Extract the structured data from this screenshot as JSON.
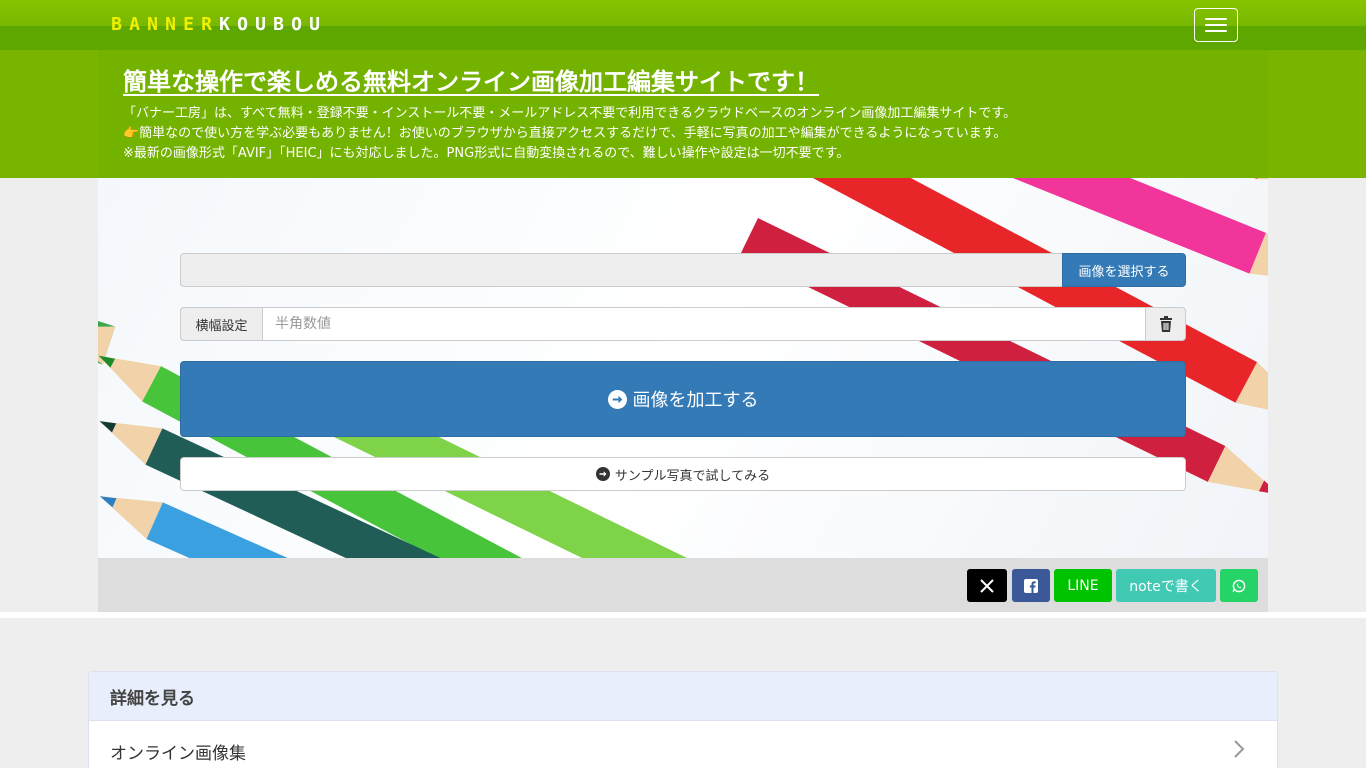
{
  "navbar": {
    "logo_letters": [
      {
        "ch": "B",
        "color": "#f0f000"
      },
      {
        "ch": "A",
        "color": "#f0f000"
      },
      {
        "ch": "N",
        "color": "#f0f000"
      },
      {
        "ch": "N",
        "color": "#f0f000"
      },
      {
        "ch": "E",
        "color": "#f0f000"
      },
      {
        "ch": "R",
        "color": "#f0f000"
      },
      {
        "ch": "K",
        "color": "#ffffff"
      },
      {
        "ch": "O",
        "color": "#ffffff"
      },
      {
        "ch": "U",
        "color": "#ffffff"
      },
      {
        "ch": "B",
        "color": "#ffffff"
      },
      {
        "ch": "O",
        "color": "#ffffff"
      },
      {
        "ch": "U",
        "color": "#ffffff"
      }
    ],
    "menu_icon": "hamburger-icon"
  },
  "hero": {
    "title": "簡単な操作で楽しめる無料オンライン画像加工編集サイトです！",
    "line1": "「バナー工房」は、すべて無料・登録不要・インストール不要・メールアドレス不要で利用できるクラウドベースのオンライン画像加工編集サイトです。",
    "line2": "👉簡単なので使い方を学ぶ必要もありません！お使いのブラウザから直接アクセスするだけで、手軽に写真の加工や編集ができるようになっています。",
    "line3": "※最新の画像形式「AVIF」「HEIC」にも対応しました。PNG形式に自動変換されるので、難しい操作や設定は一切不要です。"
  },
  "form": {
    "select_image_label": "画像を選択する",
    "width_label": "横幅設定",
    "width_placeholder": "半角数値",
    "width_value": "",
    "process_label": "画像を加工する",
    "sample_label": "サンプル写真で試してみる"
  },
  "share": {
    "x_icon": "x-logo-icon",
    "facebook_icon": "facebook-icon",
    "line_label": "LINE",
    "note_label": "noteで書く",
    "whatsapp_icon": "whatsapp-icon"
  },
  "details": {
    "header": "詳細を見る",
    "items": [
      {
        "label": "オンライン画像集"
      }
    ]
  },
  "colors": {
    "brand_green": "#78b400",
    "primary_blue": "#337ab7",
    "line_green": "#00c300",
    "note_teal": "#41c9b4",
    "whatsapp_green": "#25d366",
    "facebook_blue": "#3b5998"
  }
}
